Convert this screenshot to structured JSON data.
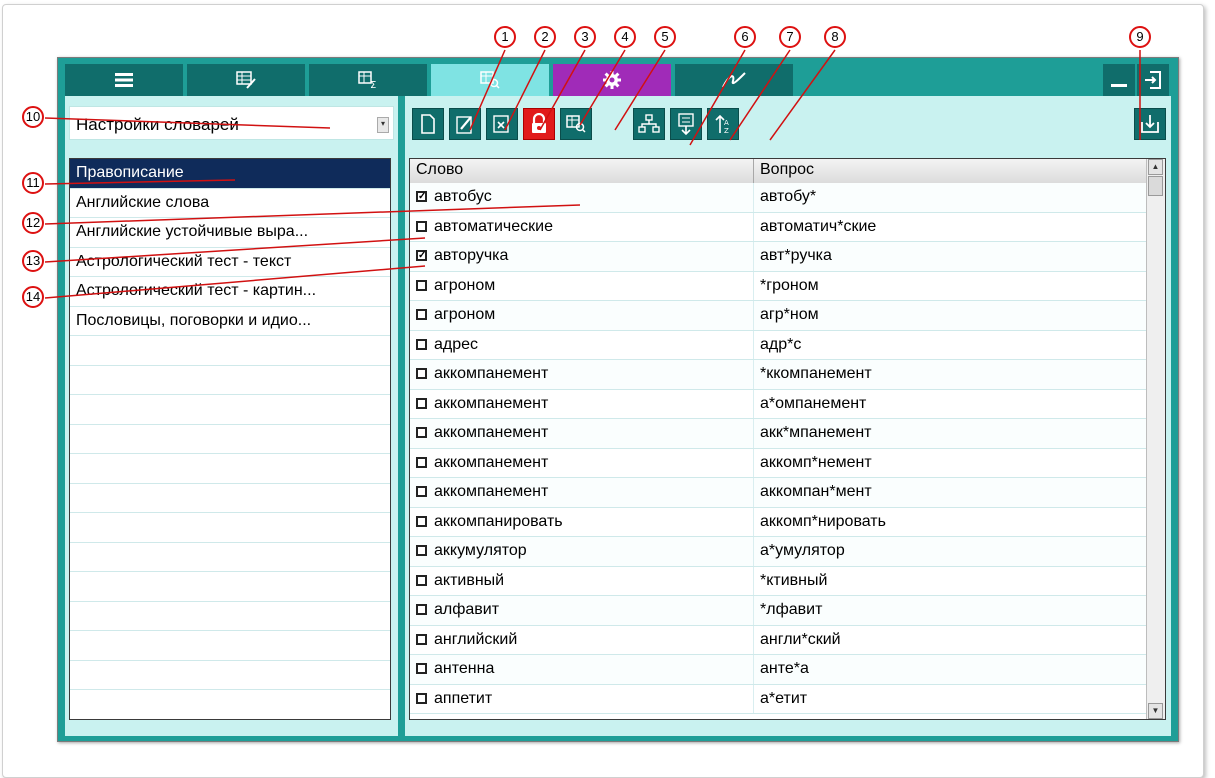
{
  "tabs": [
    {
      "icon": "list-icon"
    },
    {
      "icon": "table-edit-icon"
    },
    {
      "icon": "table-sum-icon"
    },
    {
      "icon": "table-search-icon"
    },
    {
      "icon": "gear-icon"
    },
    {
      "icon": "signature-icon"
    }
  ],
  "window_buttons": [
    "minimize-icon",
    "exit-icon"
  ],
  "dictionary_combo": {
    "value": "Настройки словарей"
  },
  "dictionaries": [
    "Правописание",
    "Английские слова",
    "Английские устойчивые выра...",
    "Астрологический тест - текст",
    "Астрологический тест - картин...",
    "Пословицы, поговорки и идио..."
  ],
  "selected_dictionary": 0,
  "toolbar": [
    "new-document-icon",
    "edit-icon",
    "delete-icon",
    "lock-icon",
    "table-search-icon",
    "hierarchy-icon",
    "move-down-icon",
    "sort-icon",
    "import-icon"
  ],
  "columns": {
    "word": "Слово",
    "question": "Вопрос"
  },
  "rows": [
    {
      "word": "автобус",
      "question": "автобу*",
      "checked": true
    },
    {
      "word": "автоматические",
      "question": "автоматич*ские",
      "checked": false
    },
    {
      "word": "авторучка",
      "question": "авт*ручка",
      "checked": true
    },
    {
      "word": "агроном",
      "question": "*гроном",
      "checked": false
    },
    {
      "word": "агроном",
      "question": "агр*ном",
      "checked": false
    },
    {
      "word": "адрес",
      "question": "адр*с",
      "checked": false
    },
    {
      "word": "аккомпанемент",
      "question": "*ккомпанемент",
      "checked": false
    },
    {
      "word": "аккомпанемент",
      "question": "а*омпанемент",
      "checked": false
    },
    {
      "word": "аккомпанемент",
      "question": "акк*мпанемент",
      "checked": false
    },
    {
      "word": "аккомпанемент",
      "question": "аккомп*немент",
      "checked": false
    },
    {
      "word": "аккомпанемент",
      "question": "аккомпан*мент",
      "checked": false
    },
    {
      "word": "аккомпанировать",
      "question": "аккомп*нировать",
      "checked": false
    },
    {
      "word": "аккумулятор",
      "question": "а*умулятор",
      "checked": false
    },
    {
      "word": "активный",
      "question": "*ктивный",
      "checked": false
    },
    {
      "word": "алфавит",
      "question": "*лфавит",
      "checked": false
    },
    {
      "word": "английский",
      "question": "англи*ский",
      "checked": false
    },
    {
      "word": "антенна",
      "question": "анте*а",
      "checked": false
    },
    {
      "word": "аппетит",
      "question": "а*етит",
      "checked": false
    }
  ],
  "callouts": [
    "1",
    "2",
    "3",
    "4",
    "5",
    "6",
    "7",
    "8",
    "9",
    "10",
    "11",
    "12",
    "13",
    "14"
  ],
  "colors": {
    "teal": "#1e9e97",
    "dark_teal": "#106d6b",
    "light_teal": "#c9f2f0",
    "purple_tab": "#a02bb8",
    "selection": "#0f2b5a",
    "callout_red": "#d11111",
    "lock_red": "#e11b1b"
  }
}
